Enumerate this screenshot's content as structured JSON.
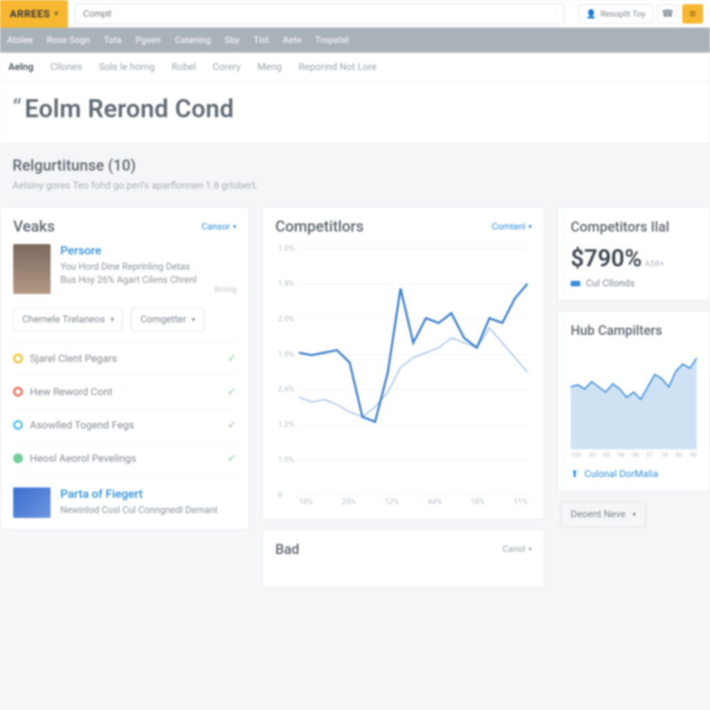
{
  "topbar": {
    "logo": "ARREES",
    "search_placeholder": "Comptl",
    "chip_label": "Resoplit Toy"
  },
  "mainnav": [
    "Atolee",
    "Rose Sogn",
    "Tota",
    "Pgeen",
    "Catening",
    "Sby",
    "Tist",
    "Aete",
    "Tropetel"
  ],
  "subnav": {
    "items": [
      "Aelng",
      "Cllones",
      "Sols le horng",
      "Robel",
      "Corery",
      "Meng",
      "Reporind Not Lore"
    ],
    "active_index": 0
  },
  "page": {
    "title": "Eolm Rerond Cond"
  },
  "section": {
    "title": "Relgurtitunse (10)",
    "subtitle": "Aelsiny gores Teo fohd go perl's aparflonnen 1.8 grlobert."
  },
  "veaks": {
    "title": "Veaks",
    "action": "Cansor",
    "person": {
      "name": "Persore",
      "desc": "You Hord Dine Reprinling Detas Bus Hoy 26% Agart Cilens Chrenl",
      "meta": "Brong"
    },
    "select1": "Chernele Trelaneos",
    "select2": "Comgetter",
    "items": [
      {
        "color": "yellow",
        "label": "Sjarel Clent Pegars"
      },
      {
        "color": "red",
        "label": "Hew Reword Cont"
      },
      {
        "color": "cyan",
        "label": "Asowlled Togend Fegs"
      },
      {
        "color": "green",
        "label": "Heosl Aeorol Pevelings"
      }
    ],
    "person2": {
      "name": "Parta of Fiegert",
      "desc": "Newinlod Cusl Cul Conngnedl Demant"
    }
  },
  "competitors": {
    "title": "Competitlors",
    "action": "Comtenl",
    "bad_title": "Bad",
    "bad_action": "Canol"
  },
  "right": {
    "panel1_title": "Competitors Ilal",
    "stat": "$790%",
    "stat_sub": "A58+",
    "legend": "Cul Cllonds",
    "panel2_title": "Hub Campilters",
    "callout": "Culonal DorMalia",
    "dropdown": "Deoent Neve"
  },
  "chart_data": {
    "type": "line",
    "title": "Competitlors",
    "xlabel": "",
    "ylabel": "",
    "y_ticks": [
      "1.0%",
      "1.8%",
      "2.0%",
      "1.0%",
      "2.6%",
      "1.2%",
      "1.0%",
      "0"
    ],
    "x_ticks": [
      "18%",
      "25%",
      "12%",
      "44%",
      "18%",
      "11%"
    ],
    "series": [
      {
        "name": "primary",
        "color": "#3a7cc9",
        "values": [
          56,
          55,
          56,
          57,
          52,
          30,
          28,
          48,
          82,
          60,
          70,
          68,
          72,
          62,
          58,
          70,
          68,
          78,
          84
        ]
      },
      {
        "name": "secondary",
        "color": "#a9c7e4",
        "values": [
          38,
          36,
          37,
          35,
          32,
          30,
          34,
          40,
          50,
          54,
          56,
          58,
          62,
          60,
          58,
          66,
          60,
          54,
          48
        ]
      }
    ]
  },
  "mini_chart": {
    "type": "area",
    "x_ticks": [
      "150",
      "30",
      "05",
      "98",
      "36",
      "01",
      "76",
      "50",
      "90"
    ],
    "values": [
      60,
      62,
      58,
      65,
      60,
      55,
      63,
      58,
      50,
      55,
      48,
      60,
      72,
      68,
      60,
      75,
      82,
      78,
      88
    ]
  }
}
